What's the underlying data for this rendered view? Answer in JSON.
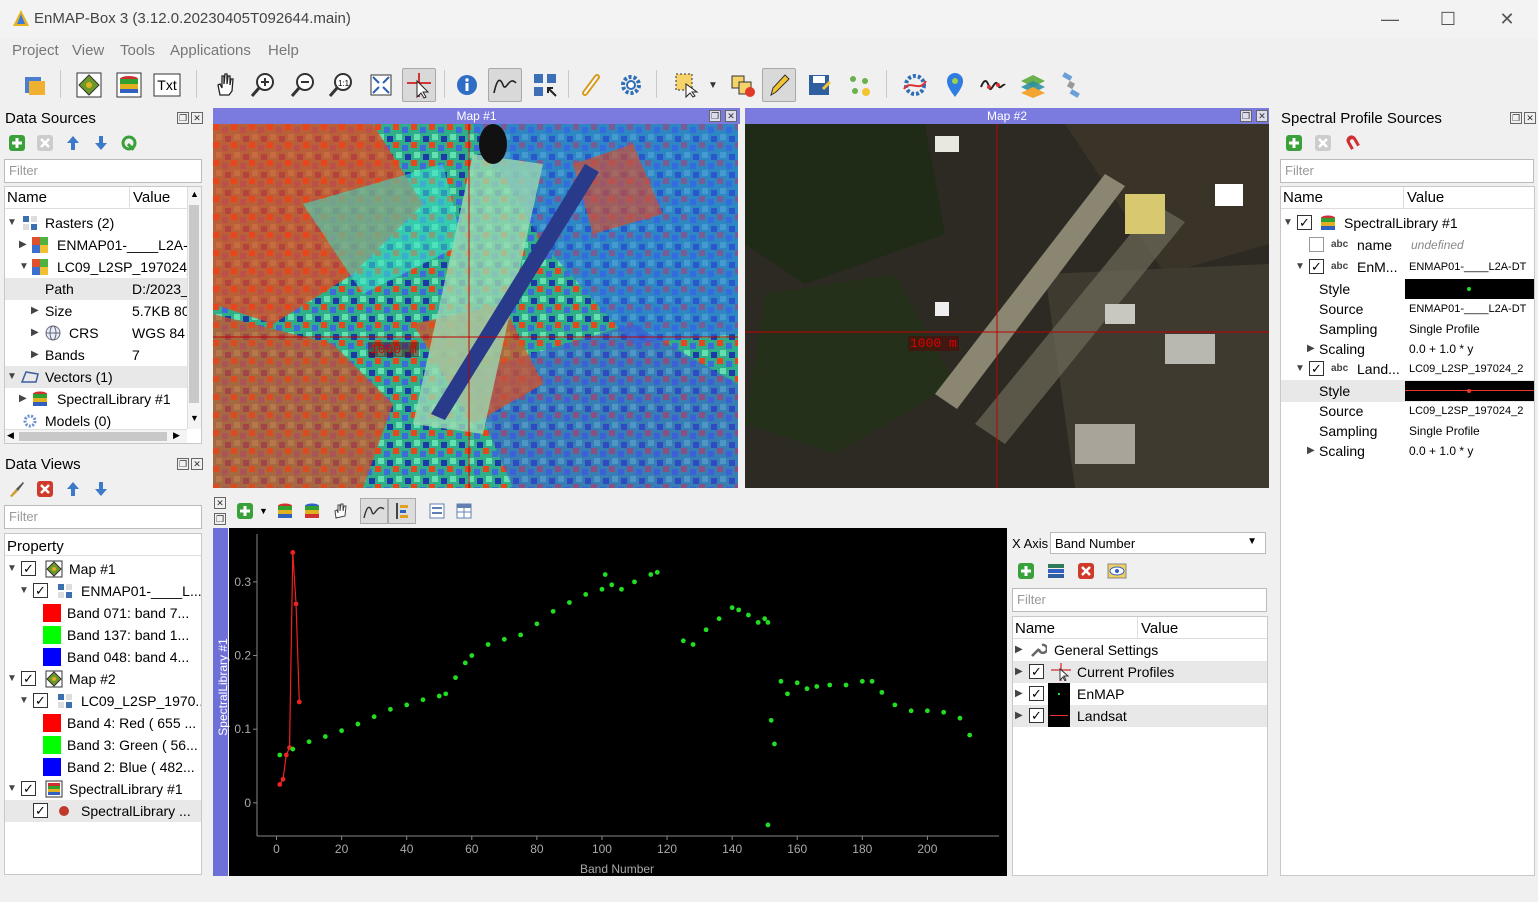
{
  "window": {
    "title": "EnMAP-Box 3 (3.12.0.20230405T092644.main)",
    "min": "—",
    "max": "☐",
    "close": "✕"
  },
  "menu": [
    "Project",
    "View",
    "Tools",
    "Applications",
    "Help"
  ],
  "toolbar": {
    "txt_label": "Txt"
  },
  "data_sources": {
    "title": "Data Sources",
    "filter_placeholder": "Filter",
    "col_name": "Name",
    "col_value": "Value",
    "rasters": "Rasters (2)",
    "raster1": "ENMAP01-____L2A-",
    "raster2": "LC09_L2SP_197024_",
    "path_label": "Path",
    "path_value": "D:/2023_",
    "size_label": "Size",
    "size_value": "5.7KB 80",
    "crs_label": "CRS",
    "crs_value": "WGS 84",
    "bands_label": "Bands",
    "bands_value": "7",
    "vectors": "Vectors (1)",
    "speclib": "SpectralLibrary #1",
    "models": "Models (0)"
  },
  "data_views": {
    "title": "Data Views",
    "filter_placeholder": "Filter",
    "col_property": "Property",
    "map1": "Map #1",
    "map1_layer": "ENMAP01-____L...",
    "map1_b1": "Band 071: band 7...",
    "map1_b2": "Band 137: band 1...",
    "map1_b3": "Band 048: band 4...",
    "map2": "Map #2",
    "map2_layer": "LC09_L2SP_1970...",
    "map2_b1": "Band 4: Red ( 655 ...",
    "map2_b2": "Band 3: Green ( 56...",
    "map2_b3": "Band 2: Blue ( 482...",
    "spec": "SpectralLibrary #1",
    "spec_layer": "SpectralLibrary ..."
  },
  "maps": {
    "map1_title": "Map #1",
    "map2_title": "Map #2",
    "scale_label": "1000 m"
  },
  "spectral_view": {
    "x_axis_label": "X Axis",
    "x_axis_value": "Band Number",
    "filter_placeholder": "Filter",
    "col_name": "Name",
    "col_value": "Value",
    "general": "General Settings",
    "current": "Current Profiles",
    "enmap": "EnMAP",
    "landsat": "Landsat"
  },
  "profile_sources": {
    "title": "Spectral Profile Sources",
    "filter_placeholder": "Filter",
    "col_name": "Name",
    "col_value": "Value",
    "lib": "SpectralLibrary #1",
    "name_label": "name",
    "name_value": "undefined",
    "enm_label": "EnM...",
    "enm_value": "ENMAP01-____L2A-DT",
    "style_label": "Style",
    "source_label": "Source",
    "sampling_label": "Sampling",
    "scaling_label": "Scaling",
    "enm_source": "ENMAP01-____L2A-DT",
    "enm_sampling": "Single Profile",
    "enm_scaling": "0.0 + 1.0 * y",
    "land_label": "Land...",
    "land_value": "LC09_L2SP_197024_2",
    "land_source": "LC09_L2SP_197024_2",
    "land_sampling": "Single Profile",
    "land_scaling": "0.0 + 1.0 * y",
    "abc": "abc"
  },
  "chart_data": {
    "type": "scatter",
    "xlabel": "Band Number",
    "ylabel": "SpectralLibrary #1",
    "xlim": [
      -6,
      222
    ],
    "ylim": [
      -0.045,
      0.365
    ],
    "xticks": [
      0,
      20,
      40,
      60,
      80,
      100,
      120,
      140,
      160,
      180,
      200
    ],
    "yticks": [
      0,
      0.1,
      0.2,
      0.3
    ],
    "ytick_labels": [
      "0",
      "0.1",
      "0.2",
      "0.3"
    ],
    "series": [
      {
        "color": "#ee2222",
        "style": "line+points",
        "x": [
          1,
          2,
          3,
          4,
          5,
          6,
          7
        ],
        "y": [
          0.025,
          0.032,
          0.065,
          0.075,
          0.34,
          0.27,
          0.137
        ]
      },
      {
        "color": "#22dd22",
        "style": "points",
        "x": [
          1,
          5,
          10,
          15,
          20,
          25,
          30,
          35,
          40,
          45,
          50,
          52,
          55,
          58,
          60,
          65,
          70,
          75,
          80,
          85,
          90,
          95,
          100,
          101,
          103,
          106,
          110,
          115,
          117,
          125,
          128,
          132,
          136,
          140,
          142,
          145,
          148,
          150,
          151,
          152,
          153,
          155,
          157,
          160,
          163,
          166,
          170,
          175,
          180,
          183,
          186,
          190,
          195,
          200,
          205,
          210,
          213
        ],
        "y": [
          0.065,
          0.073,
          0.083,
          0.09,
          0.098,
          0.107,
          0.117,
          0.127,
          0.133,
          0.14,
          0.145,
          0.148,
          0.17,
          0.19,
          0.2,
          0.215,
          0.222,
          0.228,
          0.243,
          0.26,
          0.272,
          0.283,
          0.29,
          0.31,
          0.296,
          0.29,
          0.3,
          0.31,
          0.313,
          0.22,
          0.215,
          0.235,
          0.25,
          0.265,
          0.262,
          0.255,
          0.245,
          0.25,
          0.245,
          0.112,
          0.08,
          0.165,
          0.148,
          0.163,
          0.155,
          0.158,
          0.16,
          0.16,
          0.165,
          0.165,
          0.15,
          0.133,
          0.125,
          0.125,
          0.123,
          0.115,
          0.092
        ]
      },
      {
        "color": "#22dd22",
        "style": "points",
        "x": [
          151
        ],
        "y": [
          -0.03
        ]
      }
    ]
  }
}
